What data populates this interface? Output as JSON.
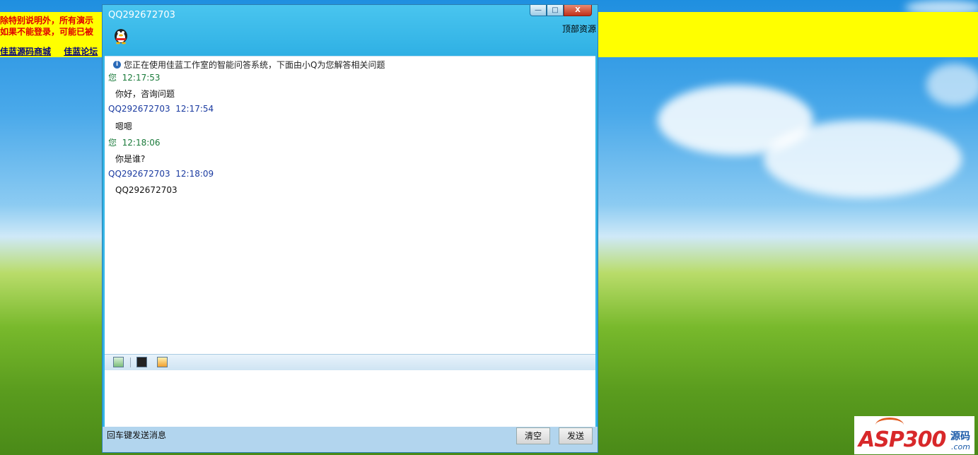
{
  "background": {
    "notice": {
      "line1": "除特别说明外，所有演示",
      "line2": "如果不能登录，可能已被"
    },
    "links": [
      "佳蓝源码商城",
      "佳蓝论坛"
    ],
    "banner_color": "#ffff00"
  },
  "watermark": {
    "brand": "ASP300",
    "cn": "源码",
    "domain": ".com"
  },
  "window": {
    "title": "QQ292672703",
    "top_resource_link": "顶部资源",
    "buttons": {
      "minimize": "—",
      "maximize": "□",
      "close": "X"
    },
    "avatar_icon": "qq-penguin-icon"
  },
  "chat": {
    "system_message": "您正在使用佳蓝工作室的智能问答系统，下面由小Q为您解答相关问题",
    "messages": [
      {
        "sender": "您",
        "time": "12:17:53",
        "text": "你好，咨询问题",
        "role": "me"
      },
      {
        "sender": "QQ292672703",
        "time": "12:17:54",
        "text": "嗯嗯",
        "role": "bot"
      },
      {
        "sender": "您",
        "time": "12:18:06",
        "text": "你是谁?",
        "role": "me"
      },
      {
        "sender": "QQ292672703",
        "time": "12:18:09",
        "text": "QQ292672703",
        "role": "bot"
      }
    ]
  },
  "toolbar": {
    "icons": [
      "refresh-icon",
      "save-icon",
      "chat-bubble-icon"
    ]
  },
  "input": {
    "value": "",
    "hint": "回车键发送消息"
  },
  "actions": {
    "clear_label": "清空",
    "send_label": "发送"
  },
  "colors": {
    "window_blue": "#33b4e6",
    "me_color": "#1a7a3a",
    "bot_color": "#1a3aa0"
  }
}
